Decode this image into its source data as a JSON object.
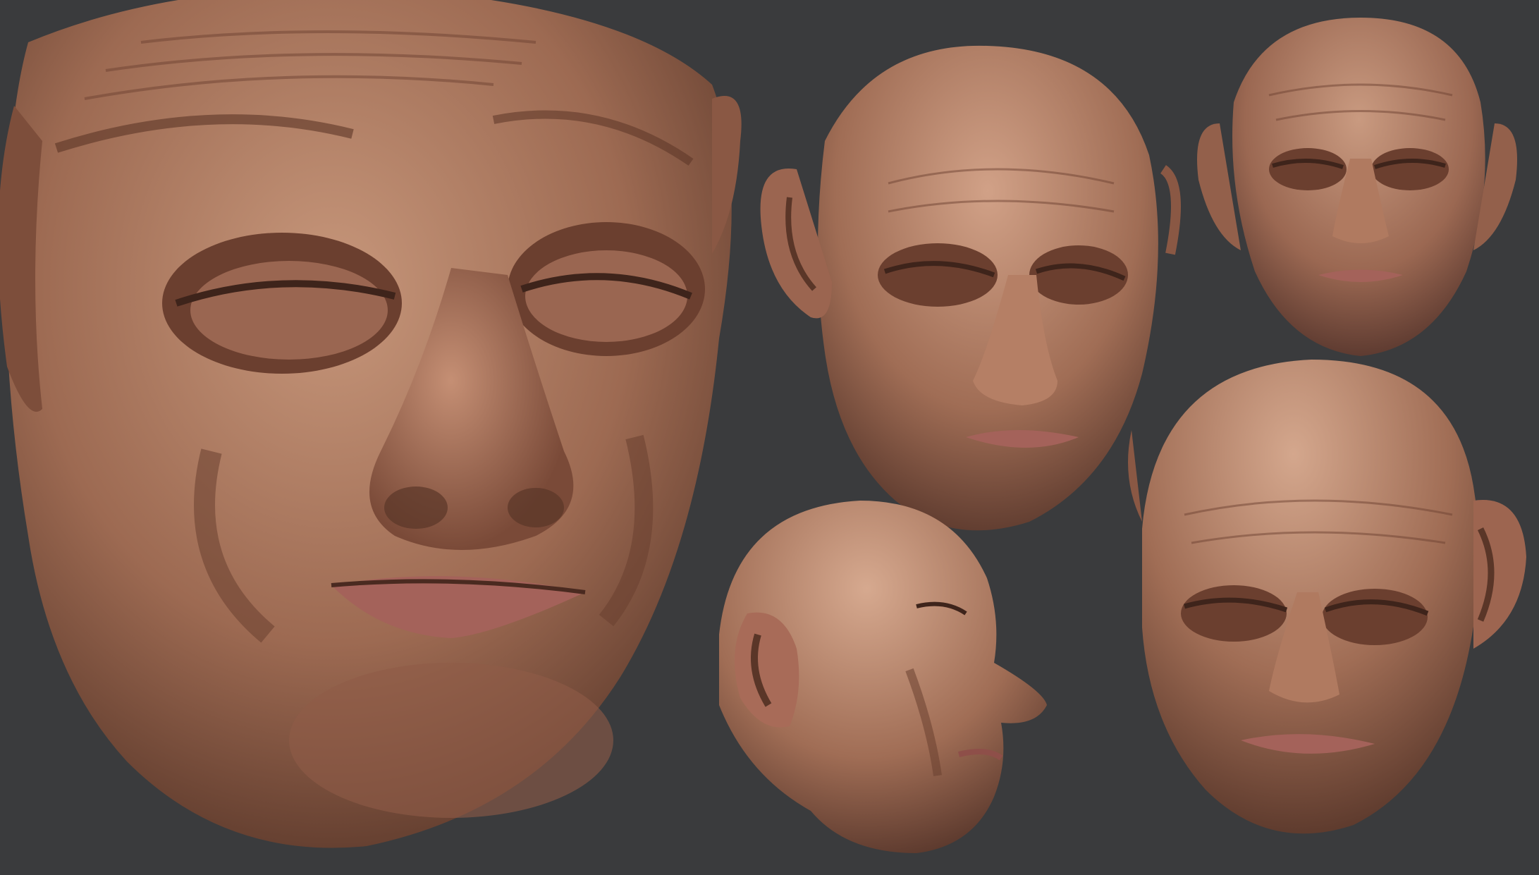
{
  "scene": {
    "background": "#3a3b3d",
    "skin_light": "#c49377",
    "skin_mid": "#9d6a52",
    "skin_dark": "#5a3628",
    "lip": "#a4625a"
  },
  "renders": [
    {
      "name": "closeup-face",
      "view": "closeup"
    },
    {
      "name": "three-quarter-head",
      "view": "three-quarter"
    },
    {
      "name": "front-head",
      "view": "front"
    },
    {
      "name": "profile-head",
      "view": "profile"
    },
    {
      "name": "low-angle-head",
      "view": "low-angle"
    }
  ]
}
